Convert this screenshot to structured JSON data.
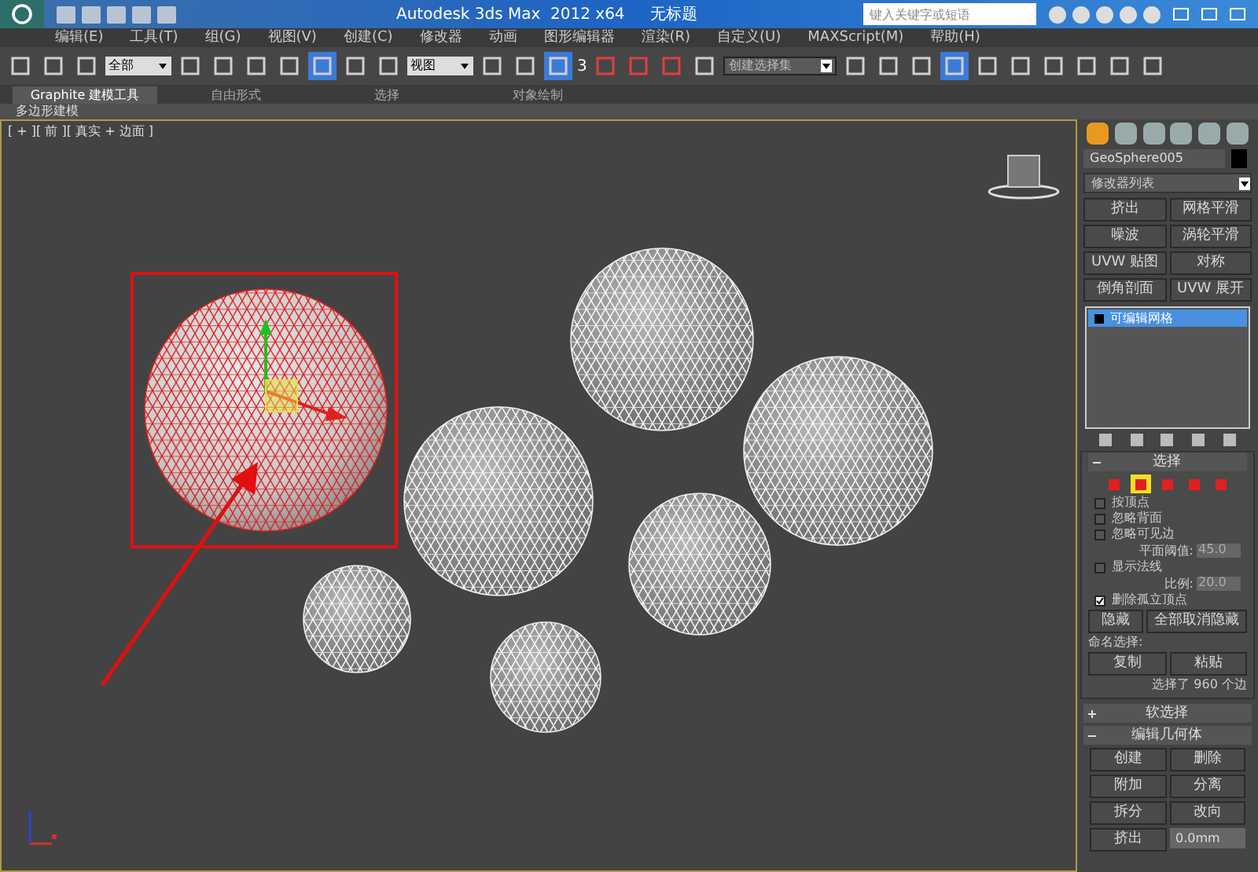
{
  "title_bar": {
    "title": "Autodesk 3ds Max  2012 x64",
    "document": "无标题",
    "search": {
      "placeholder": "键入关键字或短语"
    }
  },
  "menu": [
    "编辑(E)",
    "工具(T)",
    "组(G)",
    "视图(V)",
    "创建(C)",
    "修改器",
    "动画",
    "图形编辑器",
    "渲染(R)",
    "自定义(U)",
    "MAXScript(M)",
    "帮助(H)"
  ],
  "toolbar": {
    "filter": "全部",
    "coord": "视图",
    "selection_set": "创建选择集",
    "snap_label": "3"
  },
  "ribbon": {
    "tabs": [
      {
        "label": "Graphite 建模工具",
        "selected": true
      },
      {
        "label": "自由形式",
        "selected": false
      },
      {
        "label": "选择",
        "selected": false
      },
      {
        "label": "对象绘制",
        "selected": false
      }
    ],
    "panel": "多边形建模"
  },
  "viewport": {
    "label": "[ + ][ 前 ][ 真实 + 边面 ]",
    "spheres": [
      {
        "selected": true
      },
      {
        "selected": false
      },
      {
        "selected": false
      },
      {
        "selected": false
      },
      {
        "selected": false
      },
      {
        "selected": false
      },
      {
        "selected": false
      }
    ]
  },
  "command_panel": {
    "object_name": "GeoSphere005",
    "modifier_list": "修改器列表",
    "modifier_buttons": [
      "挤出",
      "网格平滑",
      "噪波",
      "涡轮平滑",
      "UVW 贴图",
      "对称",
      "倒角剖面",
      "UVW 展开"
    ],
    "stack": [
      {
        "label": "可编辑网格",
        "selected": true
      }
    ],
    "selection": {
      "title": "选择",
      "expanded": true,
      "subobjects": [
        {
          "selected": false
        },
        {
          "selected": true
        },
        {
          "selected": false
        },
        {
          "selected": false
        },
        {
          "selected": false
        }
      ],
      "options": [
        {
          "kind": "check",
          "label": "按顶点",
          "checked": false
        },
        {
          "kind": "check",
          "label": "忽略背面",
          "checked": false
        },
        {
          "kind": "check",
          "label": "忽略可见边",
          "checked": false
        },
        {
          "kind": "spinner",
          "label": "平面阈值:",
          "value": "45.0"
        },
        {
          "kind": "check",
          "label": "显示法线",
          "checked": false
        },
        {
          "kind": "spinner",
          "label": "比例:",
          "value": "20.0"
        },
        {
          "kind": "check",
          "label": "删除孤立顶点",
          "checked": true
        }
      ],
      "hide_buttons": [
        "隐藏",
        "全部取消隐藏"
      ],
      "named_label": "命名选择:",
      "named_buttons": [
        "复制",
        "粘贴"
      ],
      "status": "选择了 960 个边"
    },
    "soft_selection": {
      "title": "软选择",
      "expanded": false
    },
    "edit_geometry": {
      "title": "编辑几何体",
      "expanded": true,
      "buttons": [
        "创建",
        "删除",
        "附加",
        "分离",
        "拆分",
        "改向"
      ],
      "extrude": {
        "label": "挤出",
        "value": "0.0mm"
      }
    }
  }
}
